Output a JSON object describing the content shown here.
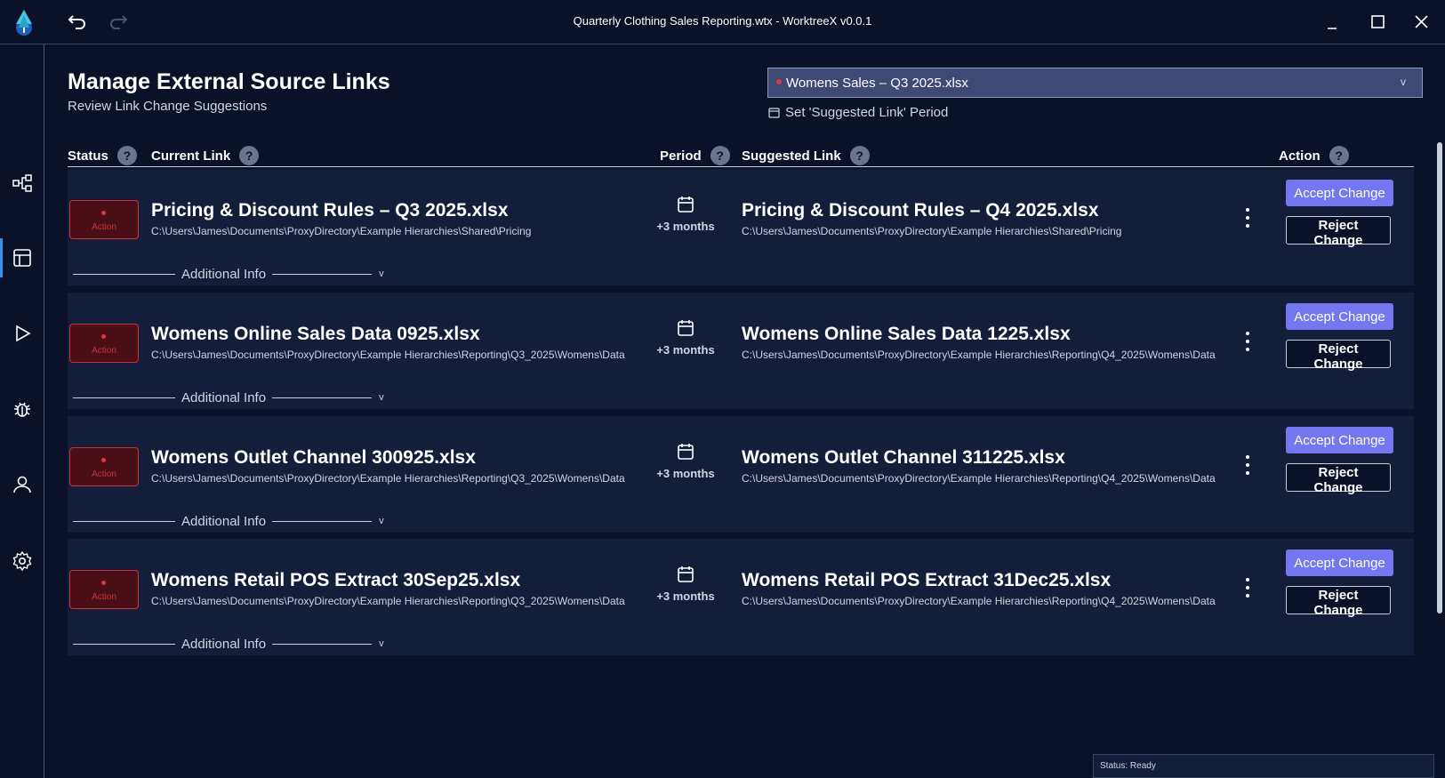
{
  "window": {
    "title": "Quarterly Clothing Sales Reporting.wtx - WorktreeX v0.0.1"
  },
  "header": {
    "title": "Manage External Source Links",
    "subtitle": "Review Link Change Suggestions",
    "file_select_value": "Womens Sales – Q3 2025.xlsx",
    "period_link_label": "Set 'Suggested Link' Period"
  },
  "columns": {
    "status": "Status",
    "current_link": "Current Link",
    "period": "Period",
    "suggested_link": "Suggested Link",
    "action": "Action",
    "help_glyph": "?"
  },
  "rows": [
    {
      "status": "Action",
      "current_name": "Pricing & Discount Rules – Q3 2025.xlsx",
      "current_path": "C:\\Users\\James\\Documents\\ProxyDirectory\\Example Hierarchies\\Shared\\Pricing",
      "period": "+3 months",
      "suggested_name": "Pricing & Discount Rules – Q4 2025.xlsx",
      "suggested_path": "C:\\Users\\James\\Documents\\ProxyDirectory\\Example Hierarchies\\Shared\\Pricing",
      "accept_label": "Accept Change",
      "reject_label": "Reject Change",
      "additional_info": "Additional Info"
    },
    {
      "status": "Action",
      "current_name": "Womens Online Sales Data 0925.xlsx",
      "current_path": "C:\\Users\\James\\Documents\\ProxyDirectory\\Example Hierarchies\\Reporting\\Q3_2025\\Womens\\Data",
      "period": "+3 months",
      "suggested_name": "Womens Online Sales Data 1225.xlsx",
      "suggested_path": "C:\\Users\\James\\Documents\\ProxyDirectory\\Example Hierarchies\\Reporting\\Q4_2025\\Womens\\Data",
      "accept_label": "Accept Change",
      "reject_label": "Reject Change",
      "additional_info": "Additional Info"
    },
    {
      "status": "Action",
      "current_name": "Womens Outlet Channel 300925.xlsx",
      "current_path": "C:\\Users\\James\\Documents\\ProxyDirectory\\Example Hierarchies\\Reporting\\Q3_2025\\Womens\\Data",
      "period": "+3 months",
      "suggested_name": "Womens Outlet Channel 311225.xlsx",
      "suggested_path": "C:\\Users\\James\\Documents\\ProxyDirectory\\Example Hierarchies\\Reporting\\Q4_2025\\Womens\\Data",
      "accept_label": "Accept Change",
      "reject_label": "Reject Change",
      "additional_info": "Additional Info"
    },
    {
      "status": "Action",
      "current_name": "Womens Retail POS Extract 30Sep25.xlsx",
      "current_path": "C:\\Users\\James\\Documents\\ProxyDirectory\\Example Hierarchies\\Reporting\\Q3_2025\\Womens\\Data",
      "period": "+3 months",
      "suggested_name": "Womens Retail POS Extract 31Dec25.xlsx",
      "suggested_path": "C:\\Users\\James\\Documents\\ProxyDirectory\\Example Hierarchies\\Reporting\\Q4_2025\\Womens\\Data",
      "accept_label": "Accept Change",
      "reject_label": "Reject Change",
      "additional_info": "Additional Info"
    }
  ],
  "statusbar": {
    "text": "Status: Ready"
  },
  "sidebar": {
    "items": [
      "hierarchy-icon",
      "table-icon",
      "play-icon",
      "bug-icon",
      "user-icon",
      "gear-icon"
    ],
    "active": "table-icon"
  },
  "colors": {
    "background": "#0a1128",
    "row": "#141d3a",
    "accent": "#7478f0",
    "status_red": "#c8323c",
    "select_bg": "#3d4a73"
  }
}
